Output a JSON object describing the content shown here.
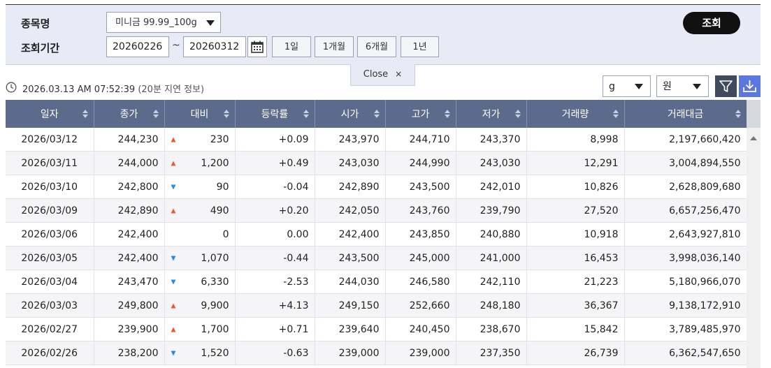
{
  "filter": {
    "item_label": "종목명",
    "item_value": "미니금 99.99_100g",
    "period_label": "조회기간",
    "start_date": "20260226",
    "end_date": "20260312",
    "tilde": "~",
    "period_buttons": [
      "1일",
      "1개월",
      "6개월",
      "1년"
    ],
    "search_label": "조회"
  },
  "close_label": "Close",
  "close_x": "×",
  "timestamp": "2026.03.13 AM 07:52:39",
  "timestamp_note": "(20분 지연 정보)",
  "unit_weight": "g",
  "unit_currency": "원",
  "colors": {
    "up": "#e35b3a",
    "down": "#2c8ad8",
    "header": "#5c6a8c",
    "panel": "#e8eaf6"
  },
  "icons": {
    "clock": "clock-icon",
    "calendar": "calendar-icon",
    "filter": "filter-icon",
    "download": "download-icon",
    "sort": "sort-icon"
  },
  "columns": [
    "일자",
    "종가",
    "대비",
    "등락률",
    "시가",
    "고가",
    "저가",
    "거래량",
    "거래대금"
  ],
  "rows": [
    {
      "date": "2026/03/12",
      "close": "244,230",
      "dir": "up",
      "change": "230",
      "rate": "+0.09",
      "open": "243,970",
      "high": "244,710",
      "low": "243,370",
      "volume": "8,998",
      "amount": "2,197,660,420"
    },
    {
      "date": "2026/03/11",
      "close": "244,000",
      "dir": "up",
      "change": "1,200",
      "rate": "+0.49",
      "open": "243,030",
      "high": "244,990",
      "low": "243,030",
      "volume": "12,291",
      "amount": "3,004,894,550"
    },
    {
      "date": "2026/03/10",
      "close": "242,800",
      "dir": "down",
      "change": "90",
      "rate": "-0.04",
      "open": "242,890",
      "high": "243,500",
      "low": "242,010",
      "volume": "10,826",
      "amount": "2,628,809,680"
    },
    {
      "date": "2026/03/09",
      "close": "242,890",
      "dir": "up",
      "change": "490",
      "rate": "+0.20",
      "open": "242,050",
      "high": "243,760",
      "low": "239,790",
      "volume": "27,520",
      "amount": "6,657,256,470"
    },
    {
      "date": "2026/03/06",
      "close": "242,400",
      "dir": "none",
      "change": "0",
      "rate": "0.00",
      "open": "242,400",
      "high": "243,850",
      "low": "240,880",
      "volume": "10,918",
      "amount": "2,643,927,810"
    },
    {
      "date": "2026/03/05",
      "close": "242,400",
      "dir": "down",
      "change": "1,070",
      "rate": "-0.44",
      "open": "243,500",
      "high": "245,000",
      "low": "241,000",
      "volume": "16,453",
      "amount": "3,998,036,140"
    },
    {
      "date": "2026/03/04",
      "close": "243,470",
      "dir": "down",
      "change": "6,330",
      "rate": "-2.53",
      "open": "244,030",
      "high": "246,580",
      "low": "242,110",
      "volume": "21,223",
      "amount": "5,180,966,070"
    },
    {
      "date": "2026/03/03",
      "close": "249,800",
      "dir": "up",
      "change": "9,900",
      "rate": "+4.13",
      "open": "249,150",
      "high": "252,660",
      "low": "248,180",
      "volume": "36,367",
      "amount": "9,138,172,910"
    },
    {
      "date": "2026/02/27",
      "close": "239,900",
      "dir": "up",
      "change": "1,700",
      "rate": "+0.71",
      "open": "239,640",
      "high": "240,450",
      "low": "238,670",
      "volume": "15,842",
      "amount": "3,789,485,970"
    },
    {
      "date": "2026/02/26",
      "close": "238,200",
      "dir": "down",
      "change": "1,520",
      "rate": "-0.63",
      "open": "239,000",
      "high": "239,000",
      "low": "237,350",
      "volume": "26,739",
      "amount": "6,362,547,650"
    }
  ]
}
